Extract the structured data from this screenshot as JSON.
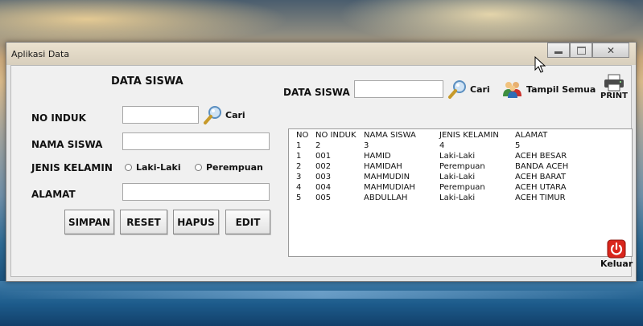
{
  "window": {
    "title": "Aplikasi Data",
    "close_glyph": "✕"
  },
  "form": {
    "heading": "DATA SISWA",
    "no_induk_label": "NO INDUK",
    "nama_label": "NAMA SISWA",
    "jk_label": "JENIS KELAMIN",
    "jk_options": [
      "Laki-Laki",
      "Perempuan"
    ],
    "alamat_label": "ALAMAT",
    "cari_label": "Cari",
    "no_induk_value": "",
    "nama_value": "",
    "alamat_value": "",
    "buttons": {
      "simpan": "SIMPAN",
      "reset": "RESET",
      "hapus": "HAPUS",
      "edit": "EDIT"
    }
  },
  "search": {
    "label": "DATA SISWA",
    "value": "",
    "cari_label": "Cari",
    "tampil_label": "Tampil Semua",
    "print_label": "PRINT"
  },
  "table": {
    "headers": [
      "NO",
      "NO INDUK",
      "NAMA SISWA",
      "JENIS KELAMIN",
      "ALAMAT"
    ],
    "rows": [
      [
        "1",
        "2",
        "3",
        "4",
        "5"
      ],
      [
        "1",
        "001",
        "HAMID",
        "Laki-Laki",
        "ACEH BESAR"
      ],
      [
        "2",
        "002",
        "HAMIDAH",
        "Perempuan",
        "BANDA ACEH"
      ],
      [
        "3",
        "003",
        "MAHMUDIN",
        "Laki-Laki",
        "ACEH BARAT"
      ],
      [
        "4",
        "004",
        "MAHMUDIAH",
        "Perempuan",
        "ACEH UTARA"
      ],
      [
        "5",
        "005",
        "ABDULLAH",
        "Laki-Laki",
        "ACEH TIMUR"
      ]
    ]
  },
  "exit_label": "Keluar",
  "colors": {
    "accent_red": "#d9261c",
    "window_bg": "#f0f0f0"
  }
}
